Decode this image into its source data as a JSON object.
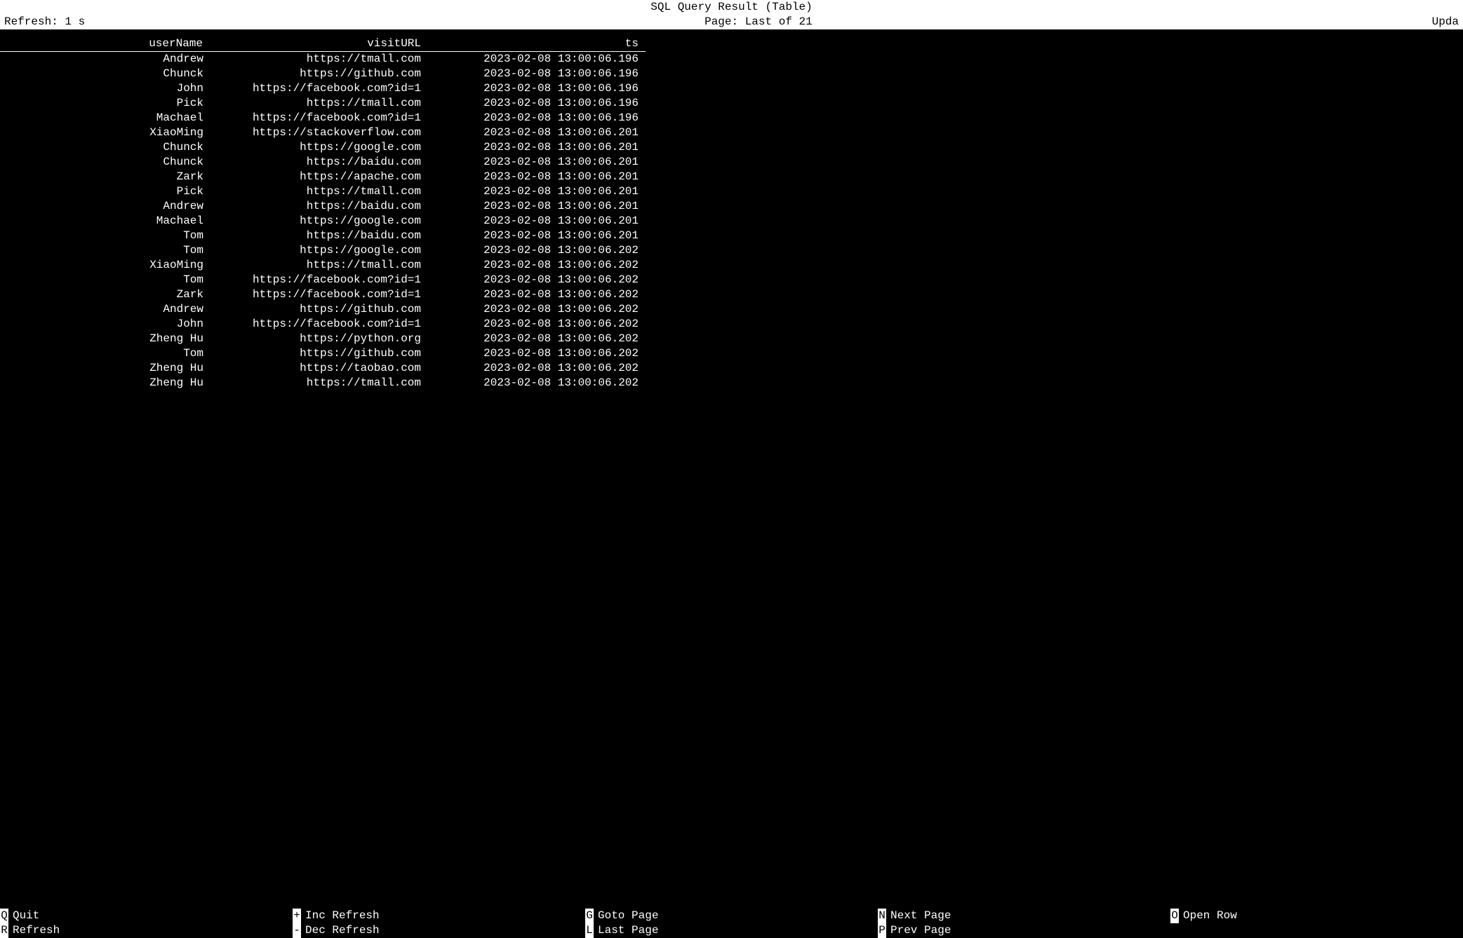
{
  "header": {
    "title": "SQL Query Result (Table)",
    "refresh_label": "Refresh: 1 s",
    "page_label": "Page: Last of 21",
    "updated_label": "Upda"
  },
  "columns": {
    "c1": "userName",
    "c2": "visitURL",
    "c3": "ts"
  },
  "rows": [
    {
      "userName": "Andrew",
      "visitURL": "https://tmall.com",
      "ts": "2023-02-08 13:00:06.196"
    },
    {
      "userName": "Chunck",
      "visitURL": "https://github.com",
      "ts": "2023-02-08 13:00:06.196"
    },
    {
      "userName": "John",
      "visitURL": "https://facebook.com?id=1",
      "ts": "2023-02-08 13:00:06.196"
    },
    {
      "userName": "Pick",
      "visitURL": "https://tmall.com",
      "ts": "2023-02-08 13:00:06.196"
    },
    {
      "userName": "Machael",
      "visitURL": "https://facebook.com?id=1",
      "ts": "2023-02-08 13:00:06.196"
    },
    {
      "userName": "XiaoMing",
      "visitURL": "https://stackoverflow.com",
      "ts": "2023-02-08 13:00:06.201"
    },
    {
      "userName": "Chunck",
      "visitURL": "https://google.com",
      "ts": "2023-02-08 13:00:06.201"
    },
    {
      "userName": "Chunck",
      "visitURL": "https://baidu.com",
      "ts": "2023-02-08 13:00:06.201"
    },
    {
      "userName": "Zark",
      "visitURL": "https://apache.com",
      "ts": "2023-02-08 13:00:06.201"
    },
    {
      "userName": "Pick",
      "visitURL": "https://tmall.com",
      "ts": "2023-02-08 13:00:06.201"
    },
    {
      "userName": "Andrew",
      "visitURL": "https://baidu.com",
      "ts": "2023-02-08 13:00:06.201"
    },
    {
      "userName": "Machael",
      "visitURL": "https://google.com",
      "ts": "2023-02-08 13:00:06.201"
    },
    {
      "userName": "Tom",
      "visitURL": "https://baidu.com",
      "ts": "2023-02-08 13:00:06.201"
    },
    {
      "userName": "Tom",
      "visitURL": "https://google.com",
      "ts": "2023-02-08 13:00:06.202"
    },
    {
      "userName": "XiaoMing",
      "visitURL": "https://tmall.com",
      "ts": "2023-02-08 13:00:06.202"
    },
    {
      "userName": "Tom",
      "visitURL": "https://facebook.com?id=1",
      "ts": "2023-02-08 13:00:06.202"
    },
    {
      "userName": "Zark",
      "visitURL": "https://facebook.com?id=1",
      "ts": "2023-02-08 13:00:06.202"
    },
    {
      "userName": "Andrew",
      "visitURL": "https://github.com",
      "ts": "2023-02-08 13:00:06.202"
    },
    {
      "userName": "John",
      "visitURL": "https://facebook.com?id=1",
      "ts": "2023-02-08 13:00:06.202"
    },
    {
      "userName": "Zheng Hu",
      "visitURL": "https://python.org",
      "ts": "2023-02-08 13:00:06.202"
    },
    {
      "userName": "Tom",
      "visitURL": "https://github.com",
      "ts": "2023-02-08 13:00:06.202"
    },
    {
      "userName": "Zheng Hu",
      "visitURL": "https://taobao.com",
      "ts": "2023-02-08 13:00:06.202"
    },
    {
      "userName": "Zheng Hu",
      "visitURL": "https://tmall.com",
      "ts": "2023-02-08 13:00:06.202"
    }
  ],
  "footer": [
    {
      "key": "Q",
      "label": "Quit"
    },
    {
      "key": "+",
      "label": "Inc Refresh"
    },
    {
      "key": "G",
      "label": "Goto Page"
    },
    {
      "key": "N",
      "label": "Next Page"
    },
    {
      "key": "O",
      "label": "Open Row"
    },
    {
      "key": "R",
      "label": "Refresh"
    },
    {
      "key": "-",
      "label": "Dec Refresh"
    },
    {
      "key": "L",
      "label": "Last Page"
    },
    {
      "key": "P",
      "label": "Prev Page"
    },
    {
      "key": " ",
      "label": ""
    }
  ]
}
